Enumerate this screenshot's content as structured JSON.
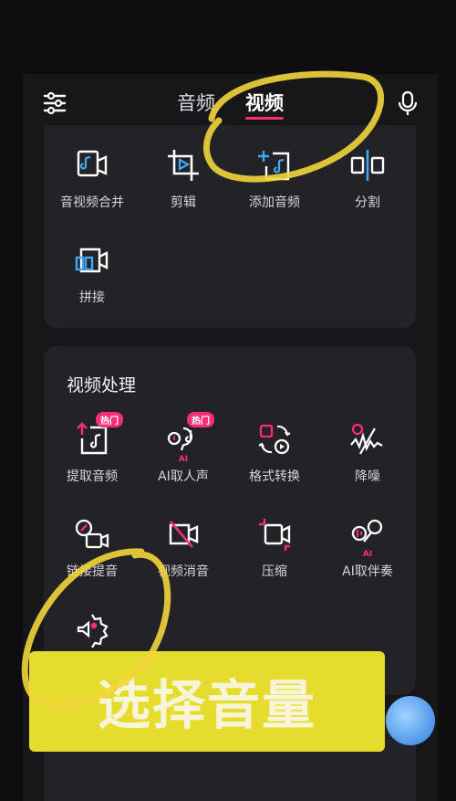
{
  "header": {
    "tabs": [
      {
        "label": "音频",
        "active": false
      },
      {
        "label": "视频",
        "active": true
      }
    ]
  },
  "top_tools": [
    {
      "label": "音视频合并",
      "icon": "merge-av-icon"
    },
    {
      "label": "剪辑",
      "icon": "crop-icon"
    },
    {
      "label": "添加音频",
      "icon": "add-audio-icon"
    },
    {
      "label": "分割",
      "icon": "split-icon"
    },
    {
      "label": "拼接",
      "icon": "join-icon"
    }
  ],
  "video_processing": {
    "title": "视频处理",
    "tools": [
      {
        "label": "提取音频",
        "icon": "extract-audio-icon",
        "badge": "热门"
      },
      {
        "label": "AI取人声",
        "icon": "ai-voice-icon",
        "badge": "热门",
        "ai": "AI"
      },
      {
        "label": "格式转换",
        "icon": "format-convert-icon"
      },
      {
        "label": "降噪",
        "icon": "denoise-icon"
      },
      {
        "label": "链接提音",
        "icon": "link-audio-icon"
      },
      {
        "label": "视频消音",
        "icon": "mute-video-icon"
      },
      {
        "label": "压缩",
        "icon": "compress-icon"
      },
      {
        "label": "AI取伴奏",
        "icon": "ai-accompaniment-icon",
        "ai": "AI"
      },
      {
        "label": "音量",
        "icon": "volume-icon"
      }
    ]
  },
  "banner": {
    "text": "选择音量"
  },
  "colors": {
    "accent": "#ff2d7a",
    "highlight": "#ffe14d",
    "icon_blue": "#3fa9f5"
  }
}
